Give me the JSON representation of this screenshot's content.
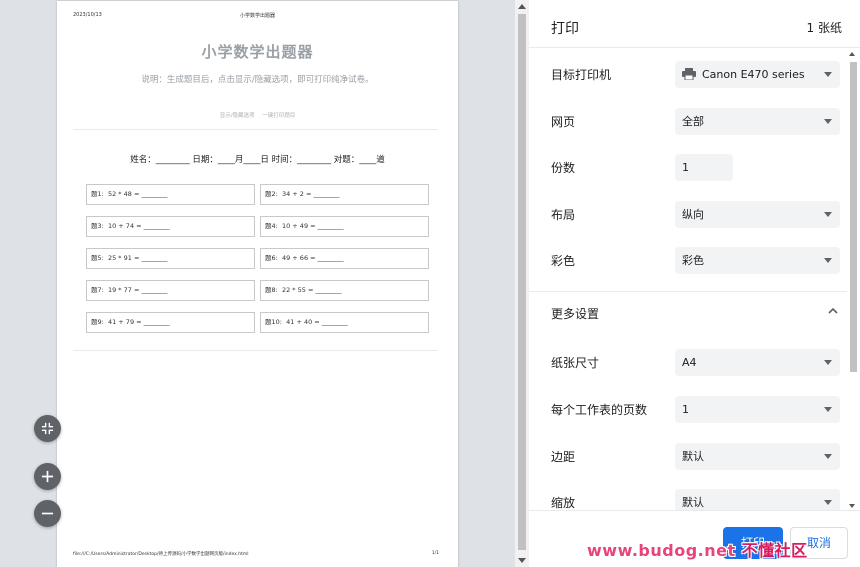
{
  "preview": {
    "header_date": "2023/10/13",
    "header_title": "小学数学出题器",
    "title": "小学数学出题器",
    "description": "说明：生成题目后，点击显示/隐藏选项，即可打印纯净试卷。",
    "links": [
      "显示/隐藏选项",
      "一键打印题目"
    ],
    "info_line": "姓名：________ 日期：____月____日 时间：________ 对题：____道",
    "questions": [
      "题1:  52 * 48 = ________",
      "题2:  34 + 2 = ________",
      "题3:  10 + 74 = ________",
      "题4:  10 + 49 = ________",
      "题5:  25 * 91 = ________",
      "题6:  49 + 66 = ________",
      "题7:  19 * 77 = ________",
      "题8:  22 * 55 = ________",
      "题9:  41 + 79 = ________",
      "题10:  41 + 40 = ________"
    ],
    "footer_path": "file:///C:/Users/Administrator/Desktop/待上传源码/小学数学出题网页版/index.html",
    "footer_page": "1/1"
  },
  "panel": {
    "title": "打印",
    "sheets": "1 张纸",
    "destination_label": "目标打印机",
    "destination_value": "Canon E470 series",
    "pages_label": "网页",
    "pages_value": "全部",
    "copies_label": "份数",
    "copies_value": "1",
    "layout_label": "布局",
    "layout_value": "纵向",
    "color_label": "彩色",
    "color_value": "彩色",
    "more_settings_label": "更多设置",
    "paper_size_label": "纸张尺寸",
    "paper_size_value": "A4",
    "pages_per_sheet_label": "每个工作表的页数",
    "pages_per_sheet_value": "1",
    "margins_label": "边距",
    "margins_value": "默认",
    "scale_label": "缩放",
    "scale_value": "默认",
    "print_button": "打印",
    "cancel_button": "取消"
  },
  "watermark": {
    "url": "www.budog.net",
    "name": "不懂社区"
  },
  "colors": {
    "accent": "#1a73e8",
    "preview_bg": "#dee1e6",
    "select_bg": "#f1f3f4"
  }
}
